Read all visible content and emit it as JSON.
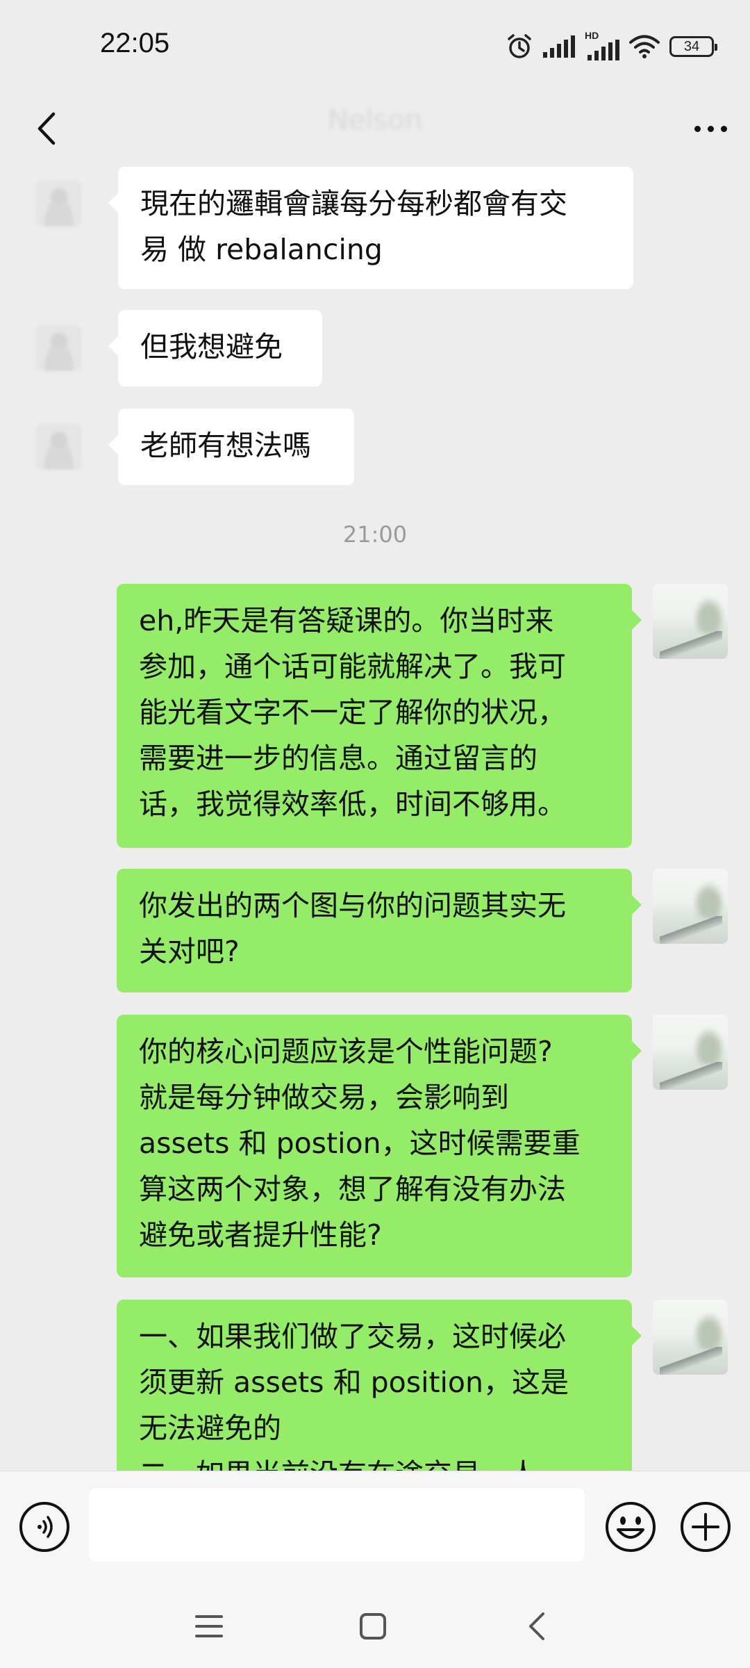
{
  "status_bar": {
    "time": "22:05",
    "network_label": "HD",
    "battery": "34",
    "icons": [
      "alarm-icon",
      "signal-icon",
      "hd-signal-icon",
      "wifi-icon",
      "battery-icon"
    ]
  },
  "header": {
    "title": "Nelson",
    "back_icon": "chevron-left-icon",
    "more_icon": "more-dots-icon"
  },
  "messages": [
    {
      "side": "in",
      "text": "現在的邏輯會讓每分每秒都會有交\n易 做 rebalancing"
    },
    {
      "side": "in",
      "text": "但我想避免"
    },
    {
      "side": "in",
      "text": "老師有想法嗎"
    },
    {
      "side": "timestamp",
      "text": "21:00"
    },
    {
      "side": "out",
      "text": "eh,昨天是有答疑课的。你当时来\n参加，通个话可能就解决了。我可\n能光看文字不一定了解你的状况，\n需要进一步的信息。通过留言的\n话，我觉得效率低，时间不够用。"
    },
    {
      "side": "out",
      "text": "你发出的两个图与你的问题其实无\n关对吧?"
    },
    {
      "side": "out",
      "text": "你的核心问题应该是个性能问题?\n就是每分钟做交易，会影响到\nassets 和 postion，这时候需要重\n算这两个对象，想了解有没有办法\n避免或者提升性能?"
    },
    {
      "side": "out",
      "text": "一、如果我们做了交易，这时候必\n须更新 assets 和 position，这是\n无法避免的\n二、如果当前没有在途交易，人"
    }
  ],
  "input_bar": {
    "placeholder": "",
    "voice_icon": "voice-icon",
    "emoji_icon": "emoji-icon",
    "plus_icon": "plus-icon"
  },
  "system_nav": {
    "icons": [
      "menu-icon",
      "home-icon",
      "back-icon"
    ]
  },
  "colors": {
    "background": "#ededed",
    "outgoing_bubble": "#95ec69",
    "incoming_bubble": "#ffffff",
    "timestamp_text": "#9a9a9a"
  }
}
